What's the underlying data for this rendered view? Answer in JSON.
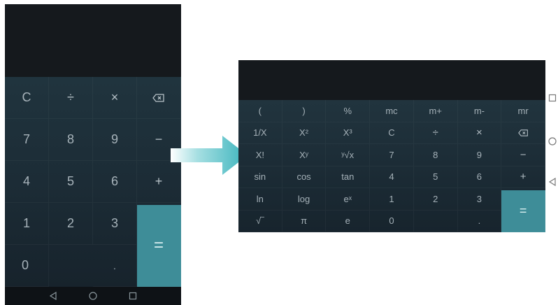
{
  "portrait": {
    "rows": [
      [
        {
          "label": "C"
        },
        {
          "label": "÷"
        },
        {
          "label": "×"
        },
        {
          "label": "backspace",
          "icon": true
        }
      ],
      [
        {
          "label": "7"
        },
        {
          "label": "8"
        },
        {
          "label": "9"
        },
        {
          "label": "−"
        }
      ],
      [
        {
          "label": "4"
        },
        {
          "label": "5"
        },
        {
          "label": "6"
        },
        {
          "label": "+"
        }
      ],
      [
        {
          "label": "1"
        },
        {
          "label": "2"
        },
        {
          "label": "3"
        },
        {
          "label": "="
        }
      ],
      [
        {
          "label": "0"
        },
        {
          "label": ""
        },
        {
          "label": "."
        },
        {
          "label": ""
        }
      ]
    ],
    "nav": [
      "back-icon",
      "home-icon",
      "recents-icon"
    ]
  },
  "landscape": {
    "rows": [
      [
        "(",
        ")",
        "%",
        "mc",
        "m+",
        "m-",
        "mr"
      ],
      [
        "1/X",
        "X²",
        "X³",
        "C",
        "÷",
        "×",
        "backspace"
      ],
      [
        "X!",
        "Xʸ",
        "ʸ√x",
        "7",
        "8",
        "9",
        "−"
      ],
      [
        "sin",
        "cos",
        "tan",
        "4",
        "5",
        "6",
        "+"
      ],
      [
        "ln",
        "log",
        "eˣ",
        "1",
        "2",
        "3",
        "="
      ],
      [
        "√‾",
        "π",
        "e",
        "0",
        "",
        ".",
        ""
      ]
    ],
    "nav": [
      "recents-icon",
      "home-icon",
      "back-icon"
    ]
  },
  "colors": {
    "accent": "#3e8d98",
    "keypad_bg": "#1c2c36",
    "display_bg": "#15191d",
    "arrow": "#3bb4bd"
  }
}
